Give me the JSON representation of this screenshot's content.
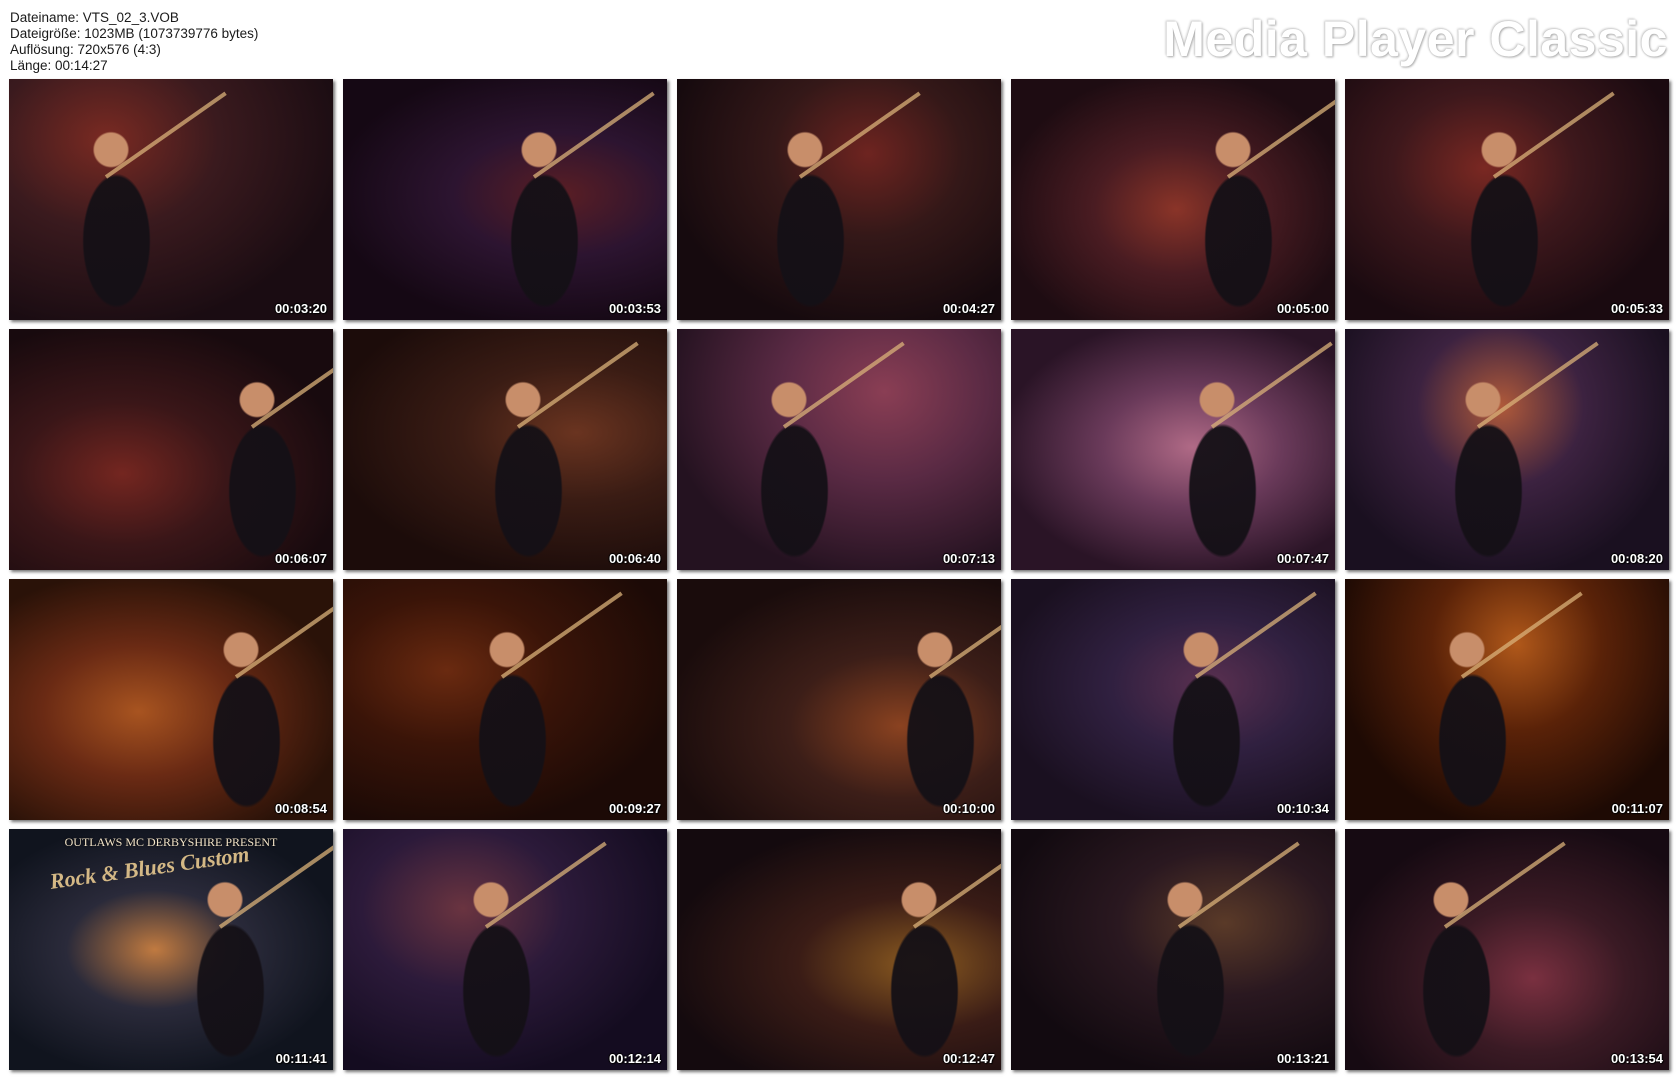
{
  "file_info": {
    "filename": "Dateiname: VTS_02_3.VOB",
    "filesize": "Dateigröße: 1023MB (1073739776 bytes)",
    "resolution": "Auflösung: 720x576 (4:3)",
    "length": "Länge: 00:14:27"
  },
  "brand": "Media Player Classic",
  "thumbnails": [
    {
      "time": "00:03:20",
      "palette": [
        "#1a0c12",
        "#3a1a1e",
        "#7a2a22"
      ]
    },
    {
      "time": "00:03:53",
      "palette": [
        "#150814",
        "#2c1430",
        "#5a1e24"
      ]
    },
    {
      "time": "00:04:27",
      "palette": [
        "#160a0e",
        "#341818",
        "#6e2420"
      ]
    },
    {
      "time": "00:05:00",
      "palette": [
        "#1e0c12",
        "#4a1c22",
        "#8a3428"
      ]
    },
    {
      "time": "00:05:33",
      "palette": [
        "#1a0a10",
        "#3e181c",
        "#7a2822"
      ]
    },
    {
      "time": "00:06:07",
      "palette": [
        "#180a0e",
        "#3a1618",
        "#742620"
      ]
    },
    {
      "time": "00:06:40",
      "palette": [
        "#1c0c0a",
        "#3a1c14",
        "#6a3420"
      ]
    },
    {
      "time": "00:07:13",
      "palette": [
        "#241220",
        "#5a2a44",
        "#8a3e54"
      ]
    },
    {
      "time": "00:07:47",
      "palette": [
        "#2a1426",
        "#6a3a5a",
        "#b06a86"
      ]
    },
    {
      "time": "00:08:20",
      "palette": [
        "#1a1020",
        "#3c2240",
        "#b05a3a"
      ]
    },
    {
      "time": "00:08:54",
      "palette": [
        "#2a1208",
        "#6a2a14",
        "#a85420"
      ]
    },
    {
      "time": "00:09:27",
      "palette": [
        "#1c0a06",
        "#3a1408",
        "#6a2a10"
      ]
    },
    {
      "time": "00:10:00",
      "palette": [
        "#1a0c0c",
        "#3c1e18",
        "#8a4220"
      ]
    },
    {
      "time": "00:10:34",
      "palette": [
        "#1a1020",
        "#302040",
        "#5a3050"
      ]
    },
    {
      "time": "00:11:07",
      "palette": [
        "#1e0a04",
        "#5a2208",
        "#b0581a"
      ]
    },
    {
      "time": "00:11:41",
      "palette": [
        "#10141e",
        "#2a2a3a",
        "#c07a40"
      ],
      "caption": "OUTLAWS MC DERBYSHIRE PRESENT",
      "caption2": "Rock & Blues Custom"
    },
    {
      "time": "00:12:14",
      "palette": [
        "#140c20",
        "#2c1a3a",
        "#6a3440"
      ]
    },
    {
      "time": "00:12:47",
      "palette": [
        "#140a0e",
        "#3a1c16",
        "#8a5a20"
      ]
    },
    {
      "time": "00:13:21",
      "palette": [
        "#120a10",
        "#2a1820",
        "#5a3a28"
      ]
    },
    {
      "time": "00:13:54",
      "palette": [
        "#160a12",
        "#3a1a24",
        "#7a3040"
      ]
    }
  ]
}
